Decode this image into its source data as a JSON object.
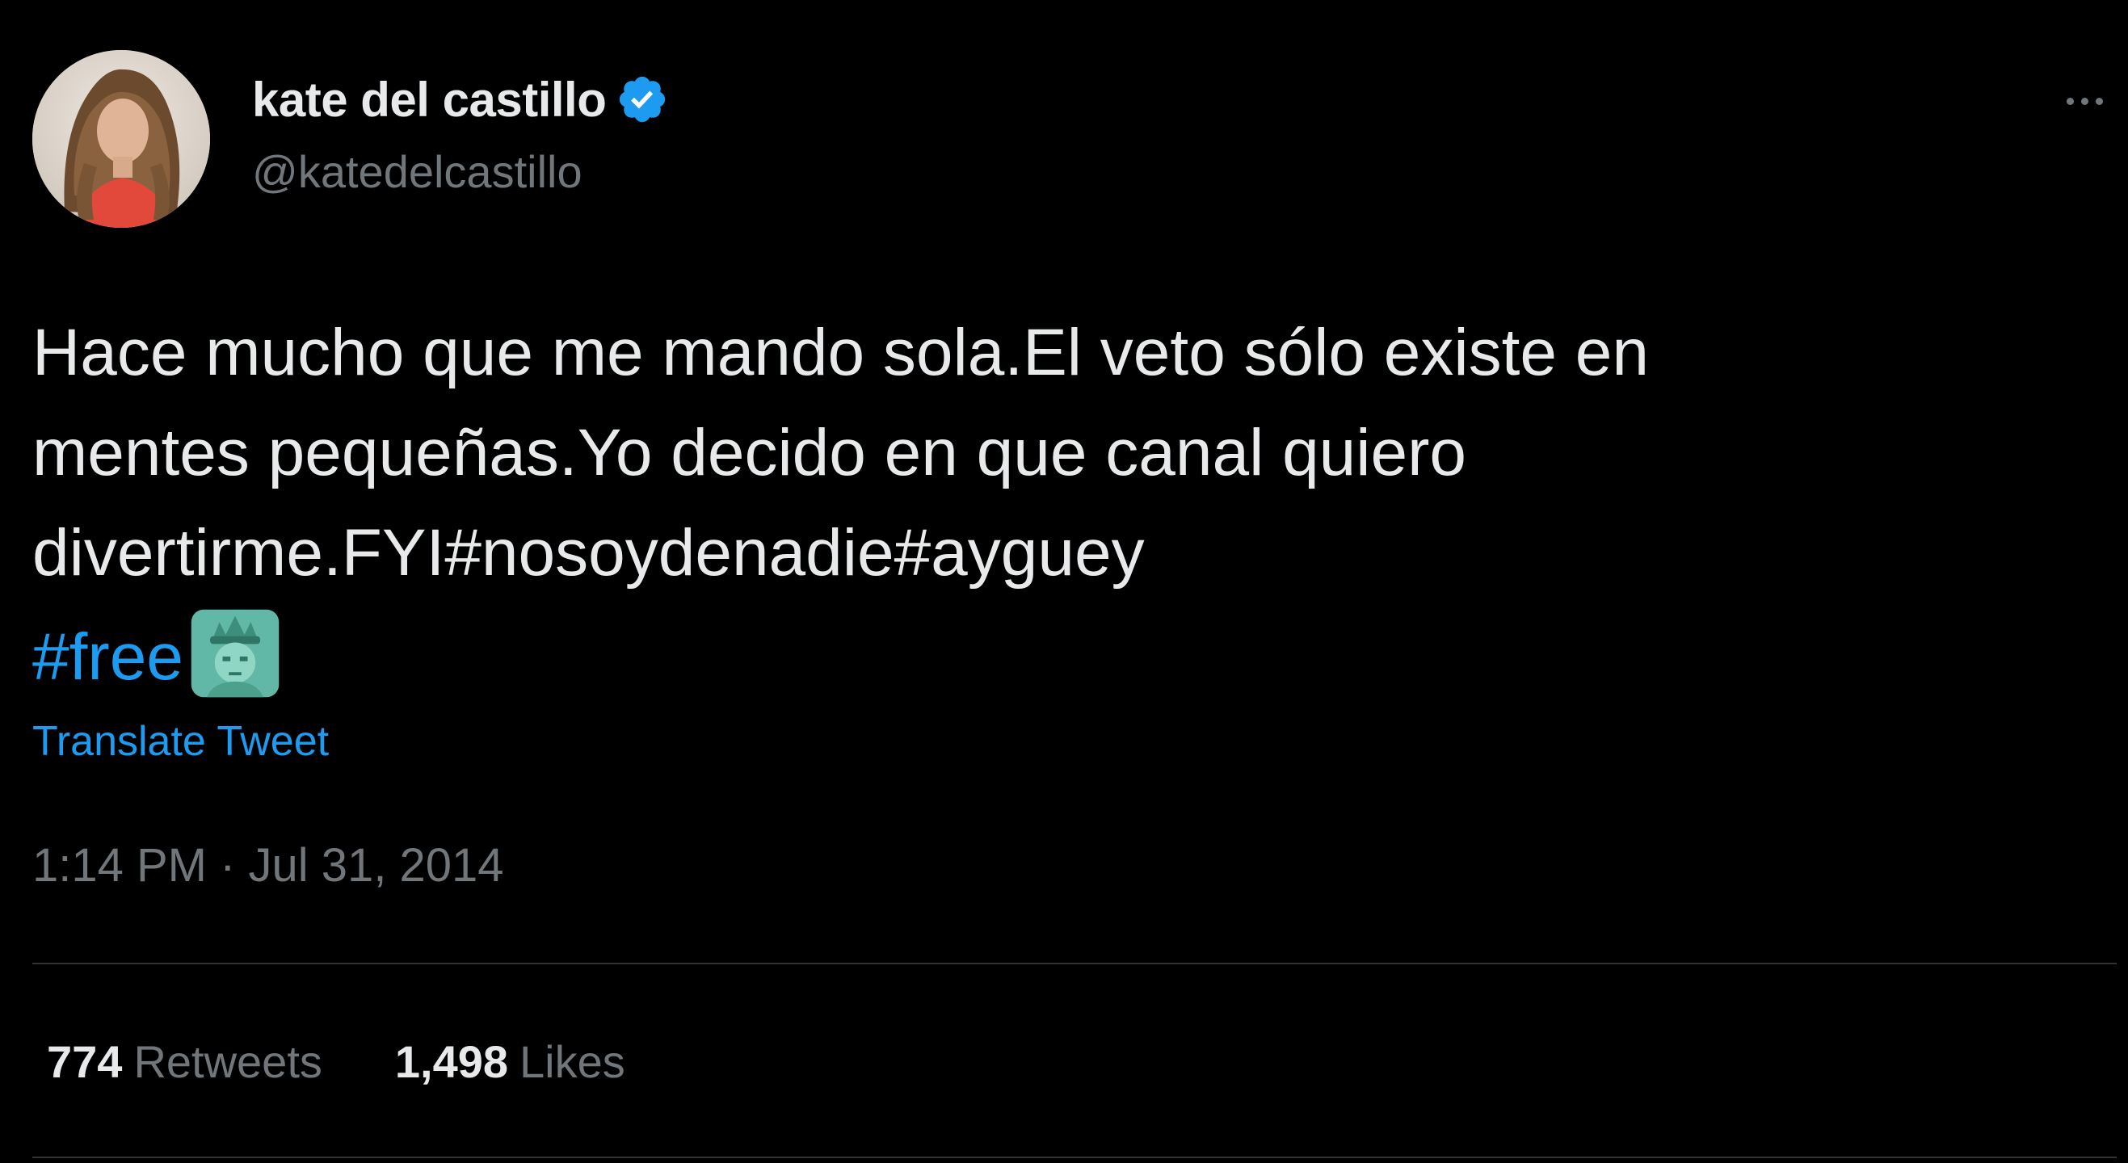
{
  "author": {
    "display_name": "kate del castillo",
    "handle": "@katedelcastillo",
    "verified_icon": "verified-badge-icon",
    "avatar_icon": "profile-photo"
  },
  "tweet": {
    "lines": [
      "Hace mucho que me mando sola.El veto sólo existe en",
      "mentes pequeñas.Yo decido en que canal quiero"
    ],
    "line3_text": "divertirme.FYI",
    "hashtags": [
      "#nosoydenadie",
      "#ayguey",
      "#free"
    ],
    "emoji": "statue-of-liberty-icon",
    "translate_label": "Translate Tweet",
    "timestamp": "1:14 PM · Jul 31, 2014"
  },
  "stats": {
    "retweets_count": "774",
    "retweets_label": "Retweets",
    "likes_count": "1,498",
    "likes_label": "Likes"
  },
  "colors": {
    "background": "#000000",
    "text": "#e7e9ea",
    "secondary": "#71767b",
    "accent": "#1d9bf0",
    "divider": "#2f3336"
  }
}
